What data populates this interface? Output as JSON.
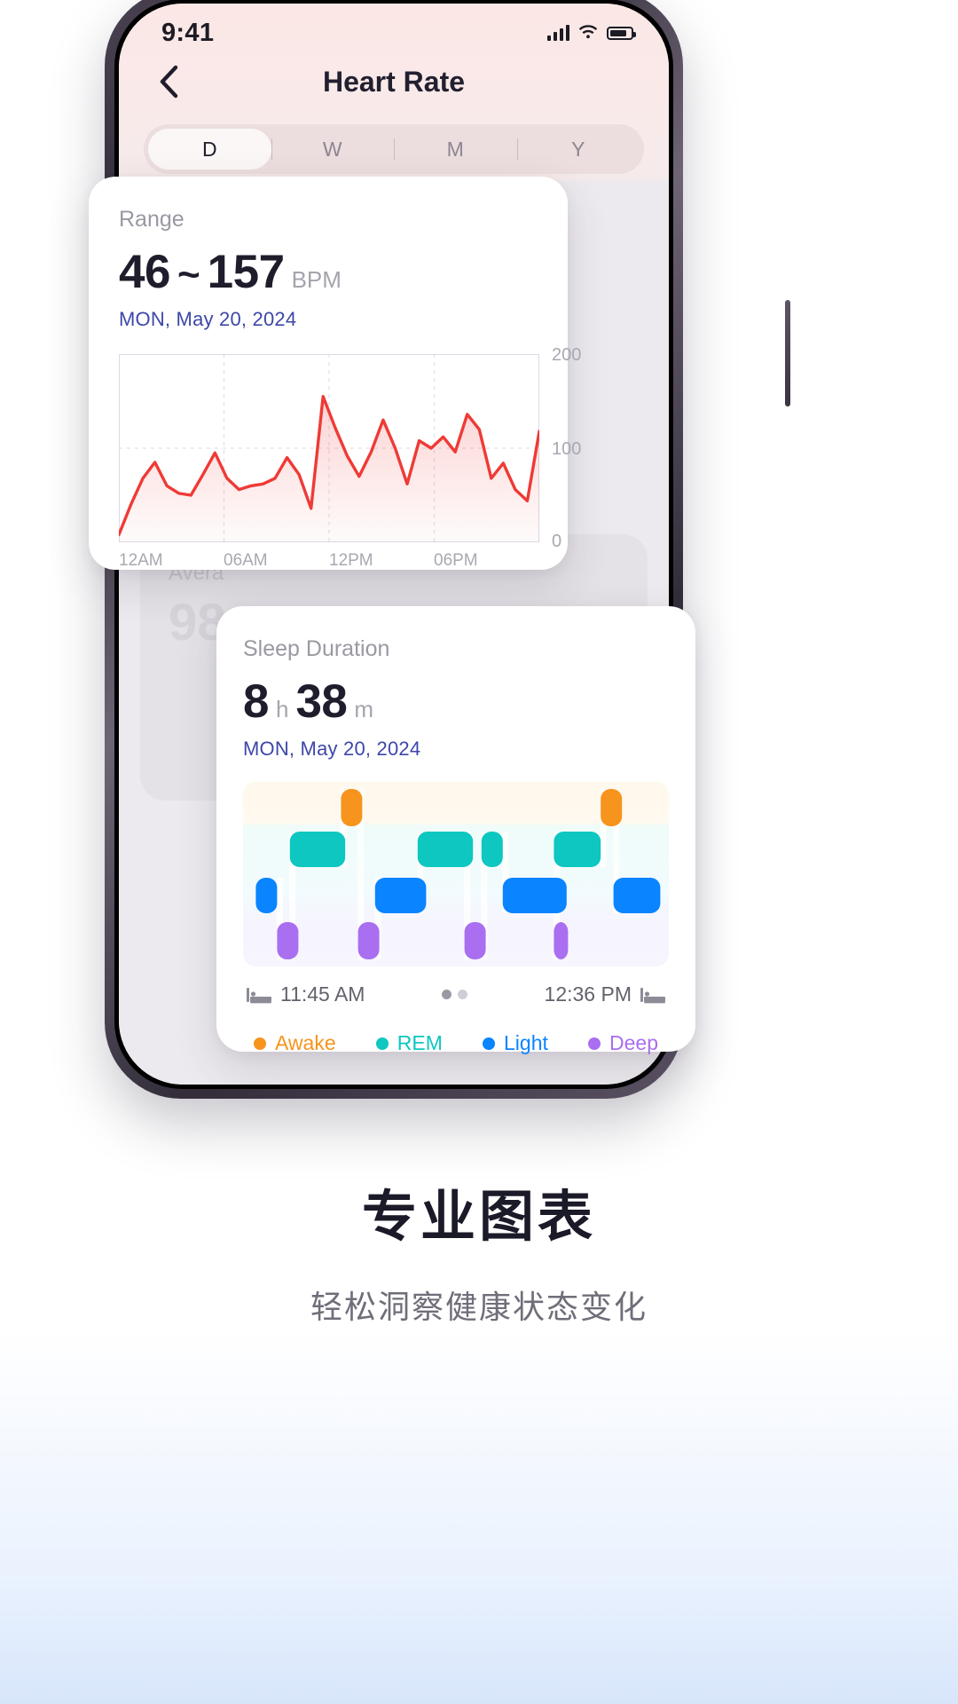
{
  "status": {
    "time": "9:41",
    "signal_icon": "signal-bars-icon",
    "wifi_icon": "wifi-icon",
    "battery_icon": "battery-icon"
  },
  "header": {
    "back_icon": "chevron-left-icon",
    "title": "Heart Rate"
  },
  "segmented": {
    "options": [
      "D",
      "W",
      "M",
      "Y"
    ],
    "selected": "D"
  },
  "ghost_card": {
    "label": "Avera",
    "value": "98"
  },
  "heart_card": {
    "title": "Range",
    "value_min": "46",
    "separator": "~",
    "value_max": "157",
    "unit": "BPM",
    "date": "MON, May 20, 2024",
    "line_color": "#ef3a36"
  },
  "sleep_card": {
    "title": "Sleep Duration",
    "hours": "8",
    "hours_unit": "h",
    "minutes": "38",
    "minutes_unit": "m",
    "date": "MON, May 20, 2024",
    "bed_icon": "bed-icon",
    "start_time": "11:45 AM",
    "end_time": "12:36 PM",
    "page_dots": 2,
    "legend": [
      {
        "label": "Awake",
        "color": "#f7941d"
      },
      {
        "label": "REM",
        "color": "#0dc7c0"
      },
      {
        "label": "Light",
        "color": "#0a84ff"
      },
      {
        "label": "Deep",
        "color": "#a濃"
      }
    ]
  },
  "promo": {
    "title": "专业图表",
    "subtitle": "轻松洞察健康状态变化"
  },
  "chart_data": [
    {
      "type": "area",
      "id": "heart-rate-chart",
      "title": "Heart Rate",
      "xlabel": "",
      "ylabel": "BPM",
      "ylim": [
        0,
        200
      ],
      "yticks": [
        0,
        100,
        200
      ],
      "ytick_labels": [
        "0",
        "100",
        "200"
      ],
      "xtick_labels": [
        "12AM",
        "06AM",
        "12PM",
        "06PM"
      ],
      "xtick_positions": [
        0,
        25,
        50,
        75
      ],
      "grid": true,
      "line_color": "#ef3a36",
      "fill_color": "rgba(239,58,54,0.12)",
      "x": [
        0,
        3,
        6,
        9,
        12,
        16,
        19,
        22,
        25,
        28,
        31,
        34,
        37,
        40,
        43,
        46,
        49,
        52,
        55,
        58,
        61,
        64,
        67,
        70,
        73,
        76,
        79,
        82,
        85,
        88,
        91,
        94,
        97,
        100
      ],
      "values": [
        8,
        40,
        68,
        85,
        60,
        52,
        50,
        72,
        95,
        68,
        56,
        60,
        62,
        68,
        90,
        72,
        36,
        155,
        122,
        92,
        70,
        96,
        130,
        100,
        62,
        108,
        100,
        112,
        96,
        136,
        120,
        68,
        84,
        56,
        44,
        118
      ]
    },
    {
      "type": "bar",
      "id": "sleep-stages-chart",
      "title": "Sleep Duration",
      "stage_order": [
        "Awake",
        "REM",
        "Light",
        "Deep"
      ],
      "stage_colors": {
        "Awake": "#f7941d",
        "REM": "#0dc7c0",
        "Light": "#0a84ff",
        "Deep": "#a96ff0"
      },
      "xlim_labels": [
        "11:45 AM",
        "12:36 PM"
      ],
      "segments": [
        {
          "stage": "Light",
          "start": 3,
          "width": 5
        },
        {
          "stage": "Deep",
          "start": 8,
          "width": 5
        },
        {
          "stage": "REM",
          "start": 11,
          "width": 13
        },
        {
          "stage": "Awake",
          "start": 23,
          "width": 5
        },
        {
          "stage": "Deep",
          "start": 27,
          "width": 5
        },
        {
          "stage": "Light",
          "start": 31,
          "width": 12
        },
        {
          "stage": "REM",
          "start": 41,
          "width": 13
        },
        {
          "stage": "Deep",
          "start": 52,
          "width": 5
        },
        {
          "stage": "REM",
          "start": 56,
          "width": 5
        },
        {
          "stage": "Light",
          "start": 61,
          "width": 15
        },
        {
          "stage": "Deep",
          "start": 73,
          "width": 3
        },
        {
          "stage": "REM",
          "start": 73,
          "width": 11
        },
        {
          "stage": "Awake",
          "start": 84,
          "width": 5
        },
        {
          "stage": "Light",
          "start": 87,
          "width": 11
        }
      ]
    }
  ]
}
